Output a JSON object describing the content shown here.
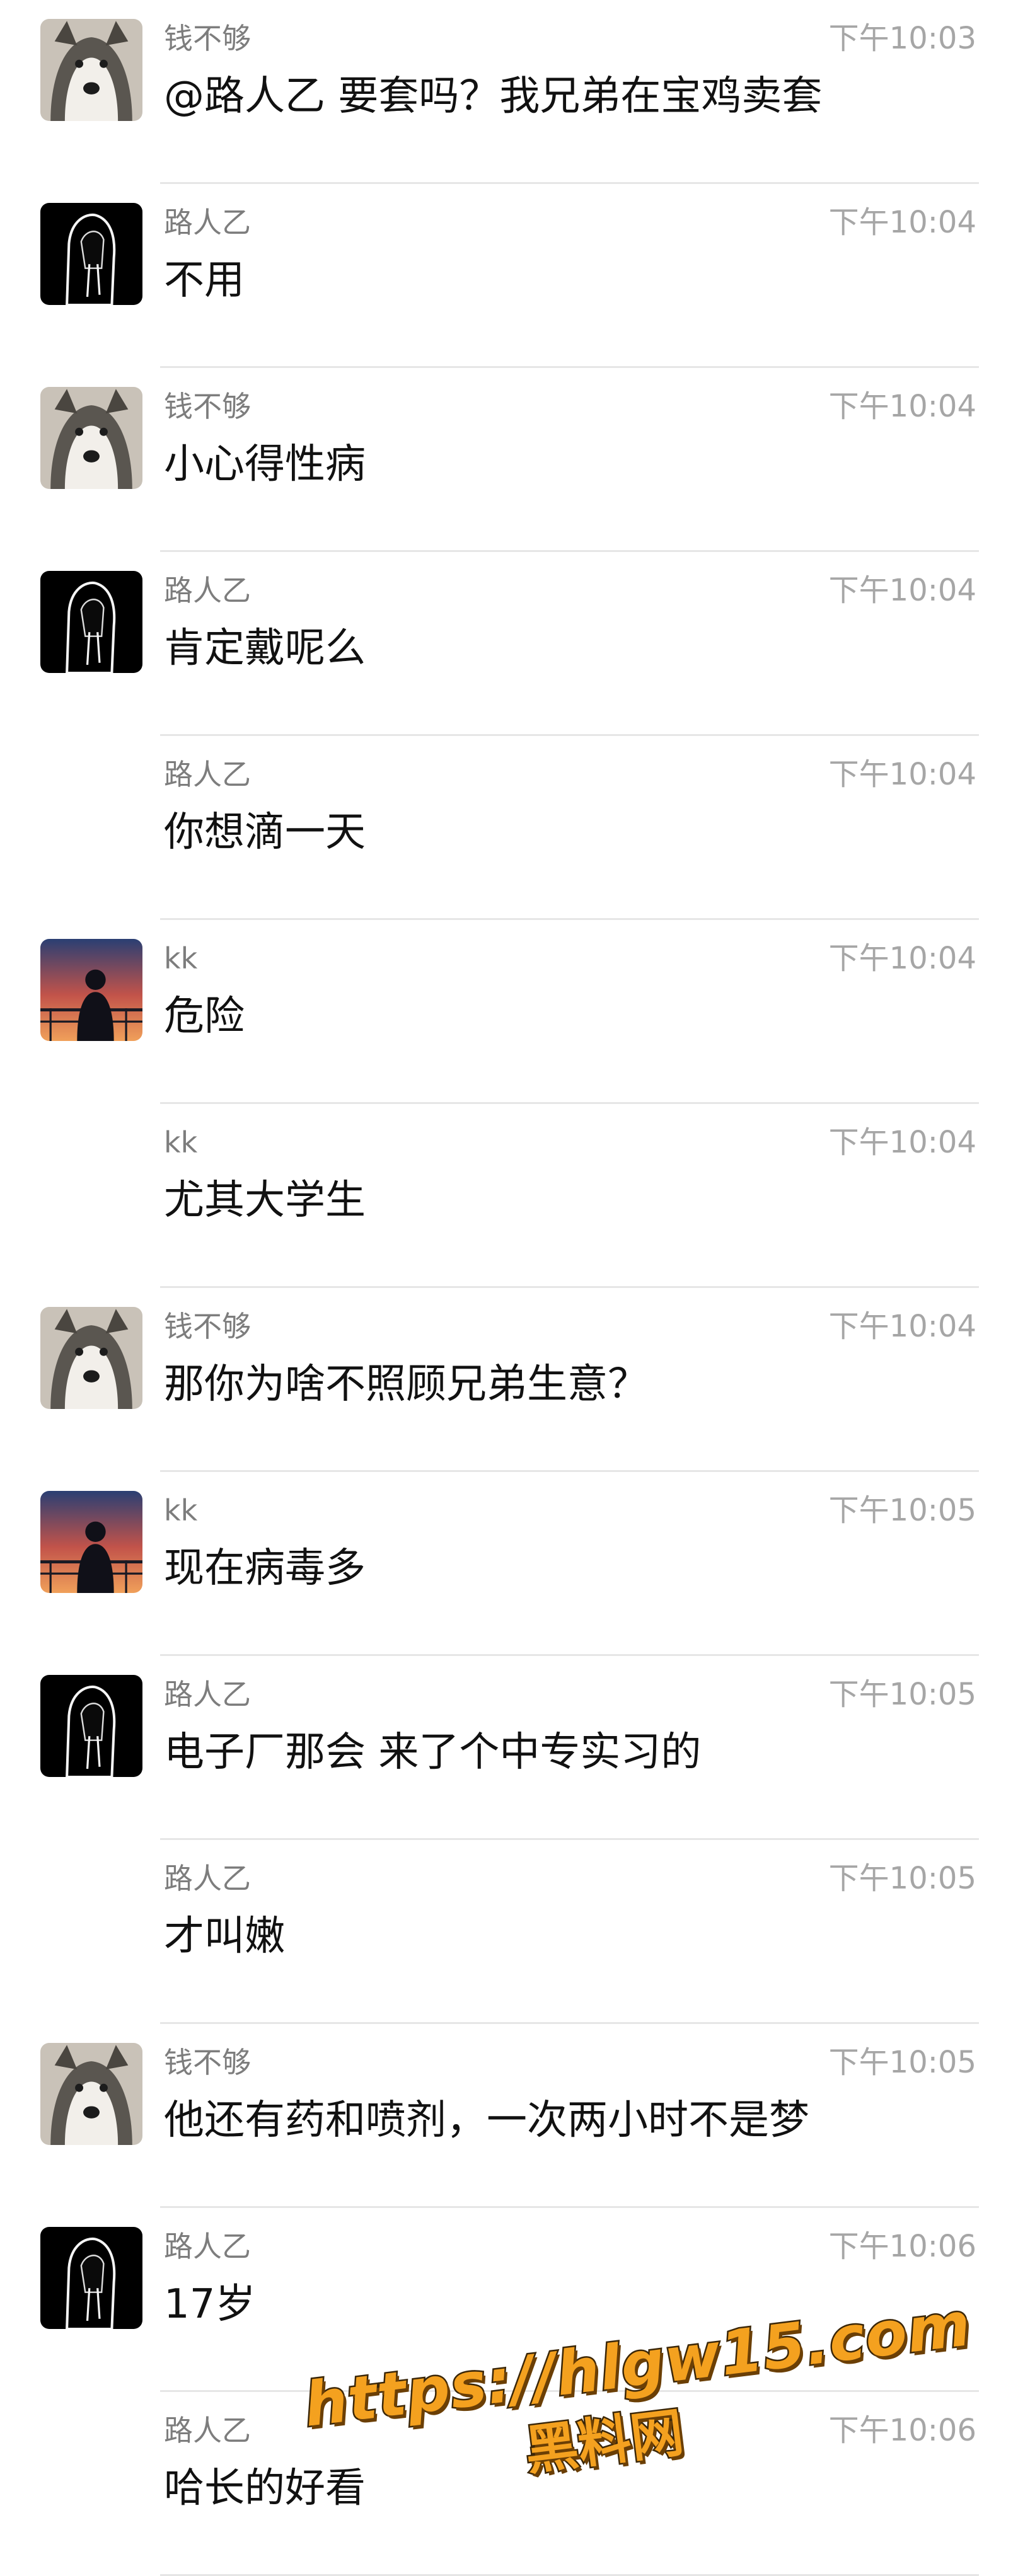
{
  "messages": [
    {
      "sender": "钱不够",
      "time": "下午10:03",
      "text": "@路人乙 要套吗？我兄弟在宝鸡卖套",
      "avatar": "husky-avatar"
    },
    {
      "sender": "路人乙",
      "time": "下午10:04",
      "text": "不用",
      "avatar": "hooded-figure-avatar"
    },
    {
      "sender": "钱不够",
      "time": "下午10:04",
      "text": "小心得性病",
      "avatar": "husky-avatar"
    },
    {
      "sender": "路人乙",
      "time": "下午10:04",
      "text": "肯定戴呢么",
      "avatar": "hooded-figure-avatar"
    },
    {
      "sender": "路人乙",
      "time": "下午10:04",
      "text": "你想滴一天",
      "avatar": ""
    },
    {
      "sender": "kk",
      "time": "下午10:04",
      "text": "危险",
      "avatar": "sunset-silhouette-avatar"
    },
    {
      "sender": "kk",
      "time": "下午10:04",
      "text": "尤其大学生",
      "avatar": ""
    },
    {
      "sender": "钱不够",
      "time": "下午10:04",
      "text": "那你为啥不照顾兄弟生意？",
      "avatar": "husky-avatar"
    },
    {
      "sender": "kk",
      "time": "下午10:05",
      "text": "现在病毒多",
      "avatar": "sunset-silhouette-avatar"
    },
    {
      "sender": "路人乙",
      "time": "下午10:05",
      "text": "电子厂那会   来了个中专实习的",
      "avatar": "hooded-figure-avatar"
    },
    {
      "sender": "路人乙",
      "time": "下午10:05",
      "text": "才叫嫩",
      "avatar": ""
    },
    {
      "sender": "钱不够",
      "time": "下午10:05",
      "text": "他还有药和喷剂，一次两小时不是梦",
      "avatar": "husky-avatar"
    },
    {
      "sender": "路人乙",
      "time": "下午10:06",
      "text": "17岁",
      "avatar": "hooded-figure-avatar"
    },
    {
      "sender": "路人乙",
      "time": "下午10:06",
      "text": "哈长的好看",
      "avatar": ""
    }
  ],
  "watermark": {
    "url": "https://hlgw15.com",
    "label": "黑料网"
  },
  "colors": {
    "sender": "#7d7d7d",
    "time": "#a6a6a6",
    "text": "#111111",
    "divider": "#e6e6e6",
    "watermark": "#f4a11f"
  }
}
